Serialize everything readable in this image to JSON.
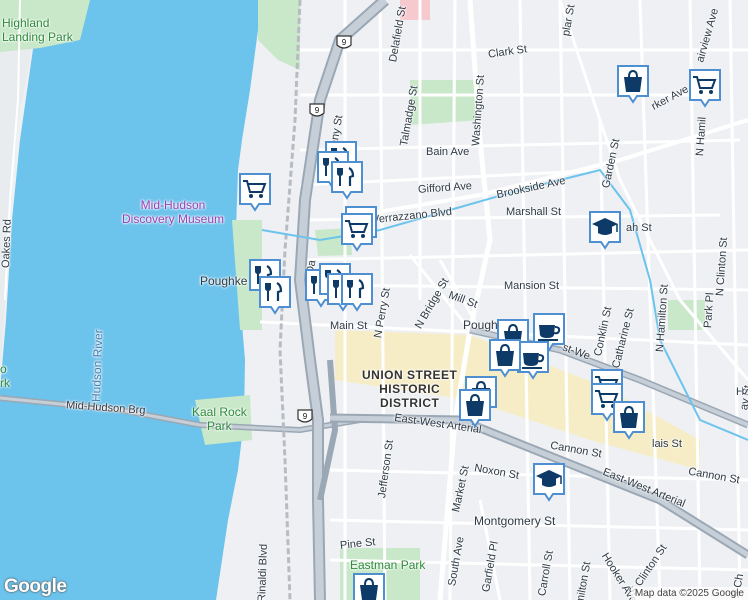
{
  "map": {
    "attribution": "Map data ©2025 Google",
    "logo": "Google",
    "colors": {
      "land": "#eef0f3",
      "water": "#6cc3ec",
      "park": "#c8e8c9",
      "highway": "#9aa7b4",
      "arterial": "#c6cfd8",
      "historic": "#f6edc6",
      "marker_fill": "#ffffff",
      "marker_border": "#4d8fd1",
      "marker_icon": "#0d3a66"
    },
    "areas": {
      "highland_landing_park": "Highland\nLanding Park",
      "discovery_museum": "Mid-Hudson\nDiscovery Museum",
      "hudson_river": "Hudson River",
      "kaal_rock_park": "Kaal Rock\nPark",
      "union_street_district": "UNION STREET\nHISTORIC\nDISTRICT",
      "eastman_park": "Eastman Park",
      "poughkeepsie_1": "Poughke",
      "poughkeepsie_2": "Pough",
      "park_cut": "o\nrk"
    },
    "streets": {
      "clark_st": "Clark St",
      "washington_st": "Washington St",
      "talmadge_st": "Talmadge St",
      "delafield_st": "Delafield St",
      "bain_ave": "Bain Ave",
      "gifford_ave": "Gifford Ave",
      "brookside_ave": "Brookside Ave",
      "verrazzano_blvd": "Verrazzano Blvd",
      "marshall_st": "Marshall St",
      "mansion_st": "Mansion St",
      "mill_st": "Mill St",
      "main_st": "Main St",
      "n_perry_st": "N Perry St",
      "n_bridge_st": "N Bridge St",
      "garden_st": "Garden St",
      "conklin_st": "Conklin St",
      "catharine_st": "Catharine St",
      "n_hamilton_st": "N Hamilton St",
      "n_clinton_st": "N Clinton St",
      "n_hamilton_top": "N Hamil",
      "park_pl": "Park Pl",
      "oakes_rd": "Oakes Rd",
      "mid_hudson_brg": "Mid-Hudson Brg",
      "east_west_arterial_1": "East-West Arterial",
      "east_west_arterial_2": "East-West Arterial",
      "east_west_arterial_3": "st-We",
      "jefferson_st": "Jefferson St",
      "cannon_st_1": "Cannon St",
      "cannon_st_2": "Cannon St",
      "noxon_st": "Noxon St",
      "market_st": "Market St",
      "montgomery_st": "Montgomery St",
      "pine_st": "Pine St",
      "south_ave": "South Ave",
      "garfield_pl": "Garfield Pl",
      "carroll_st": "Carroll St",
      "hamilton_st": "milton St",
      "hooker_ave_bottom": "Hooker Ave",
      "s_clinton_st": "S Clinton St",
      "rinaldi_blvd": "Rinaldi Blvd",
      "parker_ave": "rker Ave",
      "fairview_ave": "airview Ave",
      "poplar_st": "plar St",
      "laurel_st": "ah St",
      "any_st": "any St",
      "s_c_st": "S Ch",
      "dat_st": "Da",
      "ha_st": "Ha",
      "st_frag": "lais St",
      "ay_st": "ay St"
    },
    "route_shields": [
      "9",
      "9",
      "9"
    ],
    "markers": [
      {
        "icon": "restaurant-icon",
        "label": "restaurant"
      },
      {
        "icon": "restaurant-icon",
        "label": "restaurant"
      },
      {
        "icon": "restaurant-icon",
        "label": "restaurant"
      },
      {
        "icon": "shopping-cart-icon",
        "label": "grocery"
      },
      {
        "icon": "shopping-cart-icon",
        "label": "grocery"
      },
      {
        "icon": "shopping-cart-icon",
        "label": "grocery"
      },
      {
        "icon": "restaurant-icon",
        "label": "restaurant"
      },
      {
        "icon": "restaurant-icon",
        "label": "restaurant"
      },
      {
        "icon": "restaurant-icon",
        "label": "restaurant"
      },
      {
        "icon": "restaurant-icon",
        "label": "restaurant"
      },
      {
        "icon": "restaurant-icon",
        "label": "restaurant"
      },
      {
        "icon": "restaurant-icon",
        "label": "restaurant"
      },
      {
        "icon": "cafe-icon",
        "label": "cafe"
      },
      {
        "icon": "shopping-bag-icon",
        "label": "store"
      },
      {
        "icon": "cafe-icon",
        "label": "cafe"
      },
      {
        "icon": "shopping-bag-icon",
        "label": "store"
      },
      {
        "icon": "shopping-bag-icon",
        "label": "store"
      },
      {
        "icon": "shopping-cart-icon",
        "label": "grocery"
      },
      {
        "icon": "shopping-cart-icon",
        "label": "grocery"
      },
      {
        "icon": "shopping-bag-icon",
        "label": "store"
      },
      {
        "icon": "shopping-bag-icon",
        "label": "store"
      },
      {
        "icon": "school-icon",
        "label": "school"
      },
      {
        "icon": "school-icon",
        "label": "school"
      },
      {
        "icon": "shopping-bag-icon",
        "label": "store"
      },
      {
        "icon": "shopping-cart-icon",
        "label": "grocery"
      },
      {
        "icon": "shopping-bag-icon",
        "label": "store"
      }
    ]
  }
}
